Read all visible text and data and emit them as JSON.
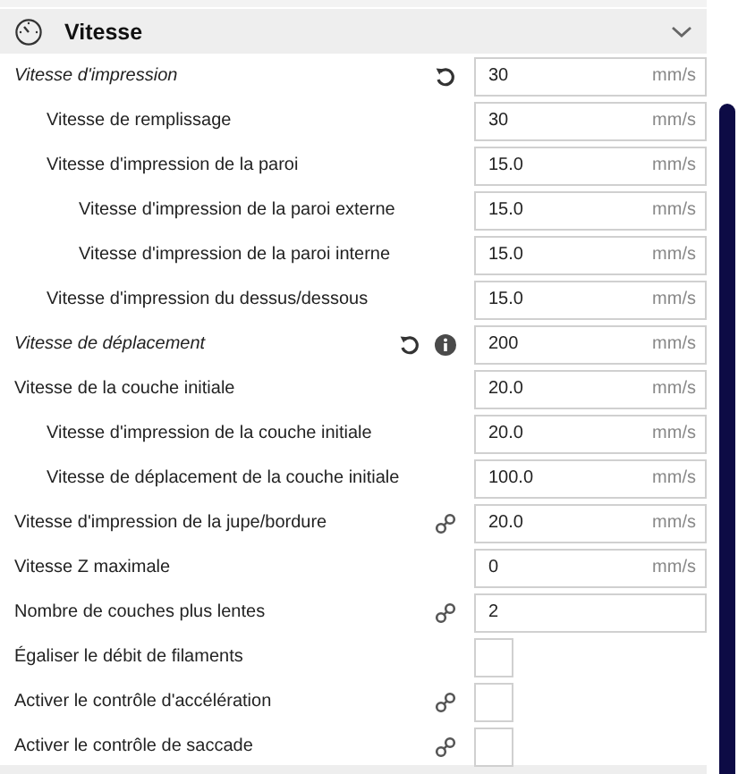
{
  "section": {
    "title": "Vitesse",
    "expanded": true
  },
  "settings": [
    {
      "label": "Vitesse d'impression",
      "kind": "number",
      "value": "30",
      "unit": "mm/s",
      "modified": true,
      "reset": true,
      "info": false,
      "linked": false,
      "children": [
        {
          "label": "Vitesse de remplissage",
          "kind": "number",
          "value": "30",
          "unit": "mm/s",
          "modified": false,
          "reset": false,
          "info": false,
          "linked": false
        },
        {
          "label": "Vitesse d'impression de la paroi",
          "kind": "number",
          "value": "15.0",
          "unit": "mm/s",
          "modified": false,
          "reset": false,
          "info": false,
          "linked": false,
          "children": [
            {
              "label": "Vitesse d'impression de la paroi externe",
              "kind": "number",
              "value": "15.0",
              "unit": "mm/s",
              "modified": false,
              "reset": false,
              "info": false,
              "linked": false
            },
            {
              "label": "Vitesse d'impression de la paroi interne",
              "kind": "number",
              "value": "15.0",
              "unit": "mm/s",
              "modified": false,
              "reset": false,
              "info": false,
              "linked": false
            }
          ]
        },
        {
          "label": "Vitesse d'impression du dessus/dessous",
          "kind": "number",
          "value": "15.0",
          "unit": "mm/s",
          "modified": false,
          "reset": false,
          "info": false,
          "linked": false
        }
      ]
    },
    {
      "label": "Vitesse de déplacement",
      "kind": "number",
      "value": "200",
      "unit": "mm/s",
      "modified": true,
      "reset": true,
      "info": true,
      "linked": false
    },
    {
      "label": "Vitesse de la couche initiale",
      "kind": "number",
      "value": "20.0",
      "unit": "mm/s",
      "modified": false,
      "reset": false,
      "info": false,
      "linked": false,
      "children": [
        {
          "label": "Vitesse d'impression de la couche initiale",
          "kind": "number",
          "value": "20.0",
          "unit": "mm/s",
          "modified": false,
          "reset": false,
          "info": false,
          "linked": false
        },
        {
          "label": "Vitesse de déplacement de la couche initiale",
          "kind": "number",
          "value": "100.0",
          "unit": "mm/s",
          "modified": false,
          "reset": false,
          "info": false,
          "linked": false
        }
      ]
    },
    {
      "label": "Vitesse d'impression de la jupe/bordure",
      "kind": "number",
      "value": "20.0",
      "unit": "mm/s",
      "modified": false,
      "reset": false,
      "info": false,
      "linked": true
    },
    {
      "label": "Vitesse Z maximale",
      "kind": "number",
      "value": "0",
      "unit": "mm/s",
      "modified": false,
      "reset": false,
      "info": false,
      "linked": false
    },
    {
      "label": "Nombre de couches plus lentes",
      "kind": "number",
      "value": "2",
      "modified": false,
      "reset": false,
      "info": false,
      "linked": true
    },
    {
      "label": "Égaliser le débit de filaments",
      "kind": "checkbox",
      "checked": false,
      "modified": false,
      "reset": false,
      "info": false,
      "linked": false
    },
    {
      "label": "Activer le contrôle d'accélération",
      "kind": "checkbox",
      "checked": false,
      "modified": false,
      "reset": false,
      "info": false,
      "linked": true
    },
    {
      "label": "Activer le contrôle de saccade",
      "kind": "checkbox",
      "checked": false,
      "modified": false,
      "reset": false,
      "info": false,
      "linked": true
    }
  ]
}
